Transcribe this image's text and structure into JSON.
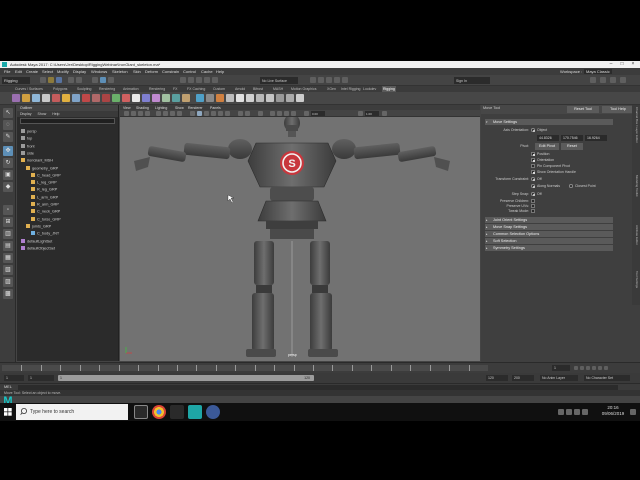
{
  "window": {
    "title": "Autodesk Maya 2017: C:\\Users\\Jer\\Desktop\\RiggingWebinar\\IronGiant_skeleton.ma*"
  },
  "menubar": [
    "File",
    "Edit",
    "Create",
    "Select",
    "Modify",
    "Display",
    "Windows",
    "Skeleton",
    "Skin",
    "Deform",
    "Constrain",
    "Control",
    "Cache",
    "Help"
  ],
  "menubar_right": [
    "Workspace :",
    "Maya Classic"
  ],
  "statusline": {
    "mode": "Rigging",
    "no_live_surface": "No Live Surface",
    "sign_in": "Sign In"
  },
  "shelf_tabs": [
    "Curves / Surfaces",
    "Polygons",
    "Sculpting",
    "Rendering",
    "Animation",
    "Rendering",
    "FX",
    "FX Caching",
    "Custom",
    "Arnold",
    "Bifrost",
    "MASH",
    "Motion Graphics",
    "XGen",
    "Intel Rigging",
    "Lookdev",
    "Rigging"
  ],
  "shelf_active_index": 16,
  "outliner": {
    "title": "Outliner",
    "menus": [
      "Display",
      "Show",
      "Help"
    ],
    "items": [
      {
        "label": "persp",
        "indent": 0,
        "kind": "camera"
      },
      {
        "label": "top",
        "indent": 0,
        "kind": "camera"
      },
      {
        "label": "front",
        "indent": 0,
        "kind": "camera"
      },
      {
        "label": "side",
        "indent": 0,
        "kind": "camera"
      },
      {
        "label": "ironGiant_MSH",
        "indent": 0,
        "kind": "group"
      },
      {
        "label": "geometry_GRP",
        "indent": 1,
        "kind": "group"
      },
      {
        "label": "C_head_GRP",
        "indent": 2,
        "kind": "group"
      },
      {
        "label": "L_leg_GRP",
        "indent": 2,
        "kind": "group"
      },
      {
        "label": "R_leg_GRP",
        "indent": 2,
        "kind": "group"
      },
      {
        "label": "L_arm_GRP",
        "indent": 2,
        "kind": "group"
      },
      {
        "label": "R_arm_GRP",
        "indent": 2,
        "kind": "group"
      },
      {
        "label": "C_neck_GRP",
        "indent": 2,
        "kind": "group"
      },
      {
        "label": "C_torso_GRP",
        "indent": 2,
        "kind": "group"
      },
      {
        "label": "joints_GRP",
        "indent": 1,
        "kind": "group"
      },
      {
        "label": "C_body_JNT",
        "indent": 2,
        "kind": "joint"
      },
      {
        "label": "defaultLightSet",
        "indent": 0,
        "kind": "set"
      },
      {
        "label": "defaultObjectSet",
        "indent": 0,
        "kind": "set"
      }
    ]
  },
  "viewport": {
    "menus": [
      "View",
      "Shading",
      "Lighting",
      "Show",
      "Renderer",
      "Panels"
    ],
    "field_a": "0.00",
    "field_b": "1.00",
    "camera_label": "persp"
  },
  "attribute_editor": {
    "title": "Move Tool",
    "reset_button": "Reset Tool",
    "help_button": "Tool Help",
    "sections": [
      {
        "label": "Move Settings",
        "expanded": true
      },
      {
        "label": "Joint Orient Settings",
        "expanded": false
      },
      {
        "label": "Move Snap Settings",
        "expanded": false
      },
      {
        "label": "Common Selection Options",
        "expanded": false
      },
      {
        "label": "Soft Selection",
        "expanded": false
      },
      {
        "label": "Symmetry Settings",
        "expanded": false
      }
    ],
    "move_settings": {
      "axis_orientation_label": "Axis Orientation:",
      "axis_orientation_value": "Object",
      "xyz_values": [
        "44.8326",
        "170.7546",
        "16.9264"
      ],
      "pivot_label": "Pivot:",
      "edit_pivot_button": "Edit Pivot",
      "reset_button": "Reset",
      "checks": [
        {
          "label": "Position",
          "checked": true
        },
        {
          "label": "Orientation",
          "checked": true
        },
        {
          "label": "Pin Component Pivot",
          "checked": false
        },
        {
          "label": "Show Orientation Handle",
          "checked": true
        }
      ],
      "transform_constraint_label": "Transform Constraint:",
      "transform_constraint_value": "Off",
      "constraint_options": [
        {
          "label": "Along Normals",
          "selected": true
        },
        {
          "label": "Closest Point",
          "selected": false
        }
      ],
      "step_snap_label": "Step Snap:",
      "step_snap_value": "Off",
      "preserve_label": "Preserve Children:",
      "preserve_uvs_label": "Preserve UVs:",
      "tweak_mode_label": "Tweak Mode:"
    }
  },
  "side_tabs": [
    "Channel Box / Layer Editor",
    "Modeling Toolkit",
    "Attribute Editor",
    "Tool Settings"
  ],
  "timeslider": {
    "ticks": [
      "5",
      "10",
      "15",
      "20",
      "25",
      "30",
      "35",
      "40",
      "45",
      "50",
      "55",
      "60",
      "65",
      "70",
      "75",
      "80",
      "85",
      "90",
      "95",
      "100",
      "105",
      "110",
      "115",
      "120"
    ],
    "current_frame": "1"
  },
  "range": {
    "start": "1",
    "inner_start": "1",
    "inner_end": "120",
    "end": "120",
    "max": "200",
    "anim_layer": "No Anim Layer",
    "char_set": "No Character Set"
  },
  "command_line": {
    "label": "MEL"
  },
  "help_line": "Move Tool: Select an object to move.",
  "taskbar": {
    "search_placeholder": "Type here to search",
    "time": "20:16",
    "date": "09/06/2019"
  },
  "colors": {
    "viewport_bg": "#727272",
    "accent": "#5d8fb7",
    "robot_emblem": "#c8373d"
  }
}
